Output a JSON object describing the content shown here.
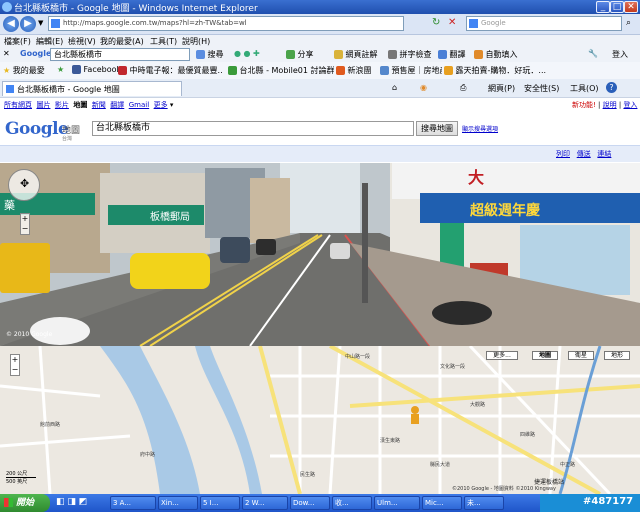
{
  "window": {
    "title": "台北縣板橋市 - Google 地圖 - Windows Internet Explorer"
  },
  "address_bar": {
    "url": "http://maps.google.com.tw/maps?hl=zh-TW&tab=wl",
    "search_placeholder": "Google"
  },
  "menu": [
    "檔案(F)",
    "編輯(E)",
    "檢視(V)",
    "我的最愛(A)",
    "工具(T)",
    "說明(H)"
  ],
  "google_toolbar": {
    "brand": "Google",
    "query": "台北縣板橋市",
    "search_label": "搜尋",
    "share_label": "分享",
    "webmark_label": "網頁註解",
    "spell_label": "拼字檢查",
    "translate_label": "翻譯",
    "autofill_label": "自動填入",
    "signin_label": "登入"
  },
  "favorites_bar": {
    "favorites_label": "我的最愛",
    "items": [
      "Facebook",
      "中時電子報：最優質最豐...",
      "台北縣 - Mobile01 討論群組",
      "新浪團",
      "預售屋｜房地產...",
      "露天拍賣-購物．好玩．..."
    ]
  },
  "tab": {
    "title": "台北縣板橋市 - Google 地圖"
  },
  "command_bar": {
    "page_label": "網頁(P)",
    "safety_label": "安全性(S)",
    "tools_label": "工具(O)"
  },
  "google_page": {
    "nav_links": [
      "所有網頁",
      "圖片",
      "影片",
      "地圖",
      "新聞",
      "翻譯",
      "Gmail",
      "更多"
    ],
    "active_nav": "地圖",
    "right_links": [
      "新功能!",
      "說明",
      "登入"
    ],
    "logo_text": "Google",
    "logo_sub": "地圖",
    "logo_region": "台灣",
    "search_value": "台北縣板橋市",
    "search_button": "搜尋地圖",
    "advanced_link": "顯示搜尋選項",
    "util_links": [
      "列印",
      "傳送",
      "連結"
    ]
  },
  "street_view": {
    "copyright": "© 2010 Google",
    "signs": [
      "板橋郵局",
      "超級週年慶",
      "藥",
      "大"
    ]
  },
  "map": {
    "buttons": [
      "更多...",
      "地圖",
      "衛星",
      "地形"
    ],
    "active_button": "地圖",
    "scale_labels": [
      "200 公尺",
      "500 英尺"
    ],
    "copyright": "©2010 Google - 地圖資料 ©2010 Kingway",
    "street_labels": [
      "中山路一段",
      "文化路一段",
      "大觀路",
      "漢生東路",
      "四維路",
      "民生路",
      "縣民大道",
      "府中路",
      "館前西路",
      "中正路"
    ],
    "station_label": "捷運板橋站"
  },
  "taskbar": {
    "start_label": "開始",
    "tasks": [
      "3 A...",
      "Xin...",
      "5 I...",
      "2 W...",
      "Dow...",
      "收...",
      "Ulm...",
      "Mic...",
      "未..."
    ],
    "watermark": "#487177"
  },
  "colors": {
    "titlebar": "#2a5cc4",
    "taskbar": "#2b62d6",
    "start": "#3a9b3a",
    "map_road_yellow": "#f7e27a",
    "river": "#a9c9e6"
  }
}
